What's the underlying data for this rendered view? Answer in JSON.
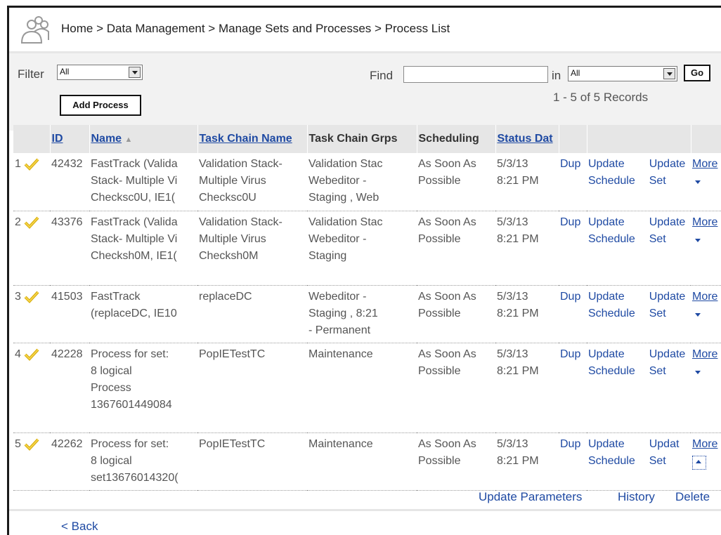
{
  "breadcrumb": "Home > Data Management > Manage Sets and Processes > Process List",
  "filter": {
    "label": "Filter",
    "value": "All"
  },
  "find": {
    "label": "Find",
    "value": "",
    "in_label": "in",
    "in_value": "All",
    "go_label": "Go"
  },
  "add_process_label": "Add Process",
  "records": "1 - 5 of 5 Records",
  "columns": {
    "id": "ID",
    "name": "Name",
    "sort_indicator": "▲",
    "task_chain_name": "Task Chain Name",
    "task_chain_grps": "Task Chain Grps",
    "scheduling": "Scheduling",
    "status_date": "Status Dat"
  },
  "rows": [
    {
      "num": "1",
      "id": "42432",
      "name": [
        "FastTrack (Valida",
        "Stack- Multiple Vi",
        "Checksc0U, IE1("
      ],
      "tcname": [
        "Validation Stack-",
        "Multiple Virus",
        "Checksc0U"
      ],
      "tcgrps": [
        "Validation Stac",
        "Webeditor -",
        "Staging ,  Web"
      ],
      "sched": [
        "As Soon As",
        "Possible"
      ],
      "date": [
        "5/3/13",
        "8:21 PM"
      ],
      "dup": "Dup",
      "update_sched": [
        "Update",
        "Schedule"
      ],
      "update_set": [
        "Update",
        "Set"
      ],
      "more": "More"
    },
    {
      "num": "2",
      "id": "43376",
      "name": [
        "FastTrack (Valida",
        "Stack- Multiple Vi",
        "Checksh0M, IE1("
      ],
      "tcname": [
        "Validation Stack-",
        "Multiple Virus",
        "Checksh0M"
      ],
      "tcgrps": [
        "Validation Stac",
        "Webeditor -",
        "Staging"
      ],
      "sched": [
        "As Soon As",
        "Possible"
      ],
      "date": [
        "5/3/13",
        "8:21 PM"
      ],
      "dup": "Dup",
      "update_sched": [
        "Update",
        "Schedule"
      ],
      "update_set": [
        "Update",
        "Set"
      ],
      "more": "More"
    },
    {
      "num": "3",
      "id": "41503",
      "name": [
        "FastTrack",
        "(replaceDC, IE10"
      ],
      "tcname": [
        "replaceDC"
      ],
      "tcgrps": [
        "Webeditor -",
        "Staging ,  8:21",
        "- Permanent"
      ],
      "sched": [
        "As Soon As",
        "Possible"
      ],
      "date": [
        "5/3/13",
        "8:21 PM"
      ],
      "dup": "Dup",
      "update_sched": [
        "Update",
        "Schedule"
      ],
      "update_set": [
        "Update",
        "Set"
      ],
      "more": "More"
    },
    {
      "num": "4",
      "id": "42228",
      "name": [
        "Process for set:",
        "8 logical",
        "Process",
        "1367601449084"
      ],
      "tcname": [
        "PopIETestTC"
      ],
      "tcgrps": [
        "Maintenance"
      ],
      "sched": [
        "As Soon As",
        "Possible"
      ],
      "date": [
        "5/3/13",
        "8:21 PM"
      ],
      "dup": "Dup",
      "update_sched": [
        "Update",
        "Schedule"
      ],
      "update_set": [
        "Update",
        "Set"
      ],
      "more": "More"
    },
    {
      "num": "5",
      "id": "42262",
      "name": [
        "Process for set:",
        "8 logical",
        "set13676014320("
      ],
      "tcname": [
        "PopIETestTC"
      ],
      "tcgrps": [
        "Maintenance"
      ],
      "sched": [
        "As Soon As",
        "Possible"
      ],
      "date": [
        "5/3/13",
        "8:21 PM"
      ],
      "dup": "Dup",
      "update_sched": [
        "Update",
        "Schedule"
      ],
      "update_set": [
        "Updat",
        "Set"
      ],
      "more": "More"
    }
  ],
  "footer_links": {
    "update_parameters": "Update Parameters",
    "history": "History",
    "delete": "Delete"
  },
  "back_label": "< Back",
  "colors": {
    "link": "#1f4aa3",
    "header_bg": "#e6e6e6",
    "toolbar_bg": "#f2f2f2"
  }
}
